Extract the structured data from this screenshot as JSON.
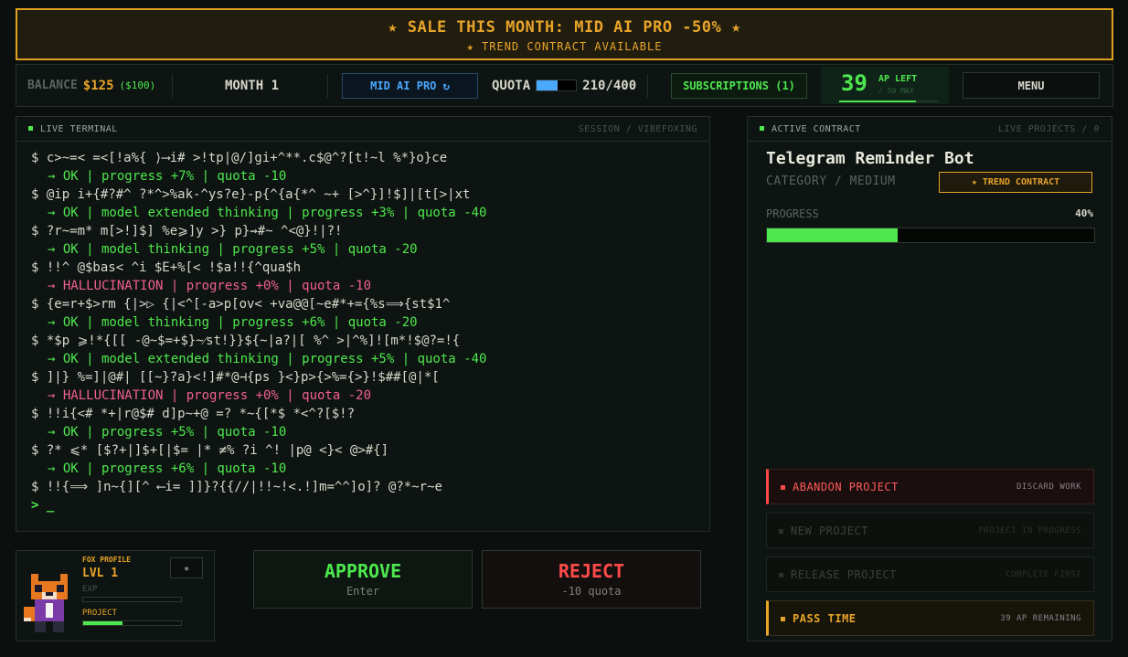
{
  "banner": {
    "title": "★ SALE THIS MONTH:  MID AI PRO  -50%  ★",
    "subtitle": "★ TREND CONTRACT AVAILABLE"
  },
  "topbar": {
    "balance_label": "BALANCE",
    "balance_value": "$125",
    "balance_sub": "($100)",
    "month": "MONTH 1",
    "model_label": "MID AI PRO ↻",
    "quota_label": "QUOTA",
    "quota_value": "210/400",
    "quota_fraction": 0.525,
    "subscriptions_label": "SUBSCRIPTIONS (1)",
    "ap_value": "39",
    "ap_label": "AP LEFT",
    "ap_max": "/ 50 MAX",
    "ap_fraction": 0.78,
    "menu_label": "MENU"
  },
  "terminal": {
    "title": "LIVE TERMINAL",
    "session": "SESSION / VIBEFOXING",
    "lines": [
      {
        "type": "cmd",
        "text": "$ c>~=< =<[!a%{ ⟩⟶i# >!tp|@/]gi+^**.c$@^?[t!~l %*}o}ce"
      },
      {
        "type": "ok",
        "text": "→ OK | progress +7% | quota -10"
      },
      {
        "type": "cmd",
        "text": "$ @ip i+{#?#^ ?*^>%ak-^ys?e}-p{^{a{*^ ~+ [>^}]!$]|[t[>|xt"
      },
      {
        "type": "ok",
        "text": "→ OK | model extended thinking | progress +3% | quota -40"
      },
      {
        "type": "cmd",
        "text": "$ ?r~=m* m[>!]$] %e⩾]y >} p}⇝#~ ^<@}!|?!"
      },
      {
        "type": "ok",
        "text": "→ OK | model thinking | progress +5% | quota -20"
      },
      {
        "type": "cmd",
        "text": "$ !!^ @$bas< ^i $E+%[< !$a!!{^qua$h"
      },
      {
        "type": "hal",
        "text": "→ HALLUCINATION | progress +0% | quota -10"
      },
      {
        "type": "cmd",
        "text": "$ {e=r+$>rm {|>▷ {|<^[-a>p[ov< +va@@[~e#*+={%s⟹{st$1^"
      },
      {
        "type": "ok",
        "text": "→ OK | model thinking | progress +6% | quota -20"
      },
      {
        "type": "cmd",
        "text": "$ *$p ⩾!*{[[ -@~$=+$}~⁄st!}}${~|a?|[ %^ >|^%]![m*!$@?=!{"
      },
      {
        "type": "ok",
        "text": "→ OK | model extended thinking | progress +5% | quota -40"
      },
      {
        "type": "cmd",
        "text": "$ ]|} %=]|@#| [[~}?a}<!]#*@⊣{ps }<}p>{>%={>}!$##[@|*["
      },
      {
        "type": "hal",
        "text": "→ HALLUCINATION | progress +0% | quota -20"
      },
      {
        "type": "cmd",
        "text": "$ !!i{<# *+|r@$# d]p~+@ =? *~{[*$ *<^?[$!?"
      },
      {
        "type": "ok",
        "text": "→ OK | progress +5% | quota -10"
      },
      {
        "type": "cmd",
        "text": "$ ?* ⩽* [$?+|]$+[|$= |* ≠% ?i ^! |p@ <}< @>#{]"
      },
      {
        "type": "ok",
        "text": "→ OK | progress +6% | quota -10"
      },
      {
        "type": "cmd",
        "text": "$ !!{⟹ ]n~{][^ ⟵i= ]]}?{{//|!!~!<.!]m=^^]o]? @?*~r~e"
      }
    ],
    "prompt": "> _"
  },
  "profile": {
    "title": "FOX PROFILE",
    "level": "LVL 1",
    "exp_label": "EXP",
    "exp_fraction": 0,
    "project_label": "PROJECT",
    "project_fraction": 0.4,
    "star": "★"
  },
  "approve": {
    "label": "APPROVE",
    "sub": "Enter"
  },
  "reject": {
    "label": "REJECT",
    "sub": "-10 quota"
  },
  "contract": {
    "title": "ACTIVE CONTRACT",
    "live": "LIVE PROJECTS / 0",
    "name": "Telegram Reminder Bot",
    "category": "CATEGORY / MEDIUM",
    "badge": "★ TREND CONTRACT",
    "progress_label": "PROGRESS",
    "progress_value": "40%",
    "progress_fraction": 0.4
  },
  "actions": {
    "abandon": {
      "label": "ABANDON PROJECT",
      "sub": "DISCARD WORK"
    },
    "new": {
      "label": "NEW PROJECT",
      "sub": "PROJECT IN PROGRESS"
    },
    "release": {
      "label": "RELEASE PROJECT",
      "sub": "COMPLETE FIRST"
    },
    "pass": {
      "label": "PASS TIME",
      "sub": "39 AP REMAINING"
    }
  },
  "colors": {
    "amber": "#e8a42a",
    "green": "#4ee84e",
    "pink": "#f06090",
    "red": "#ff4a4a",
    "blue": "#4aa8ff"
  }
}
